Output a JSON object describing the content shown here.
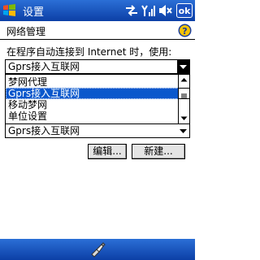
{
  "window": {
    "title": "设置",
    "ok_label": "ok"
  },
  "status_icons": [
    "connectivity-icon",
    "signal-strength-icon",
    "volume-icon"
  ],
  "section": {
    "title": "网络管理"
  },
  "prompt": "在程序自动连接到 Internet 时，使用:",
  "internet_combo": {
    "value": "Gprs接入互联网",
    "options": [
      "梦网代理",
      "Gprs接入互联网",
      "移动梦网",
      "单位设置"
    ],
    "selected_index": 1
  },
  "second_combo": {
    "value": "Gprs接入互联网"
  },
  "buttons": {
    "edit": "编辑...",
    "new": "新建..."
  },
  "menubar": {
    "icon": "keyboard-icon"
  },
  "colors": {
    "titlebar": "#1b52c2",
    "selection": "#0a58cc"
  }
}
